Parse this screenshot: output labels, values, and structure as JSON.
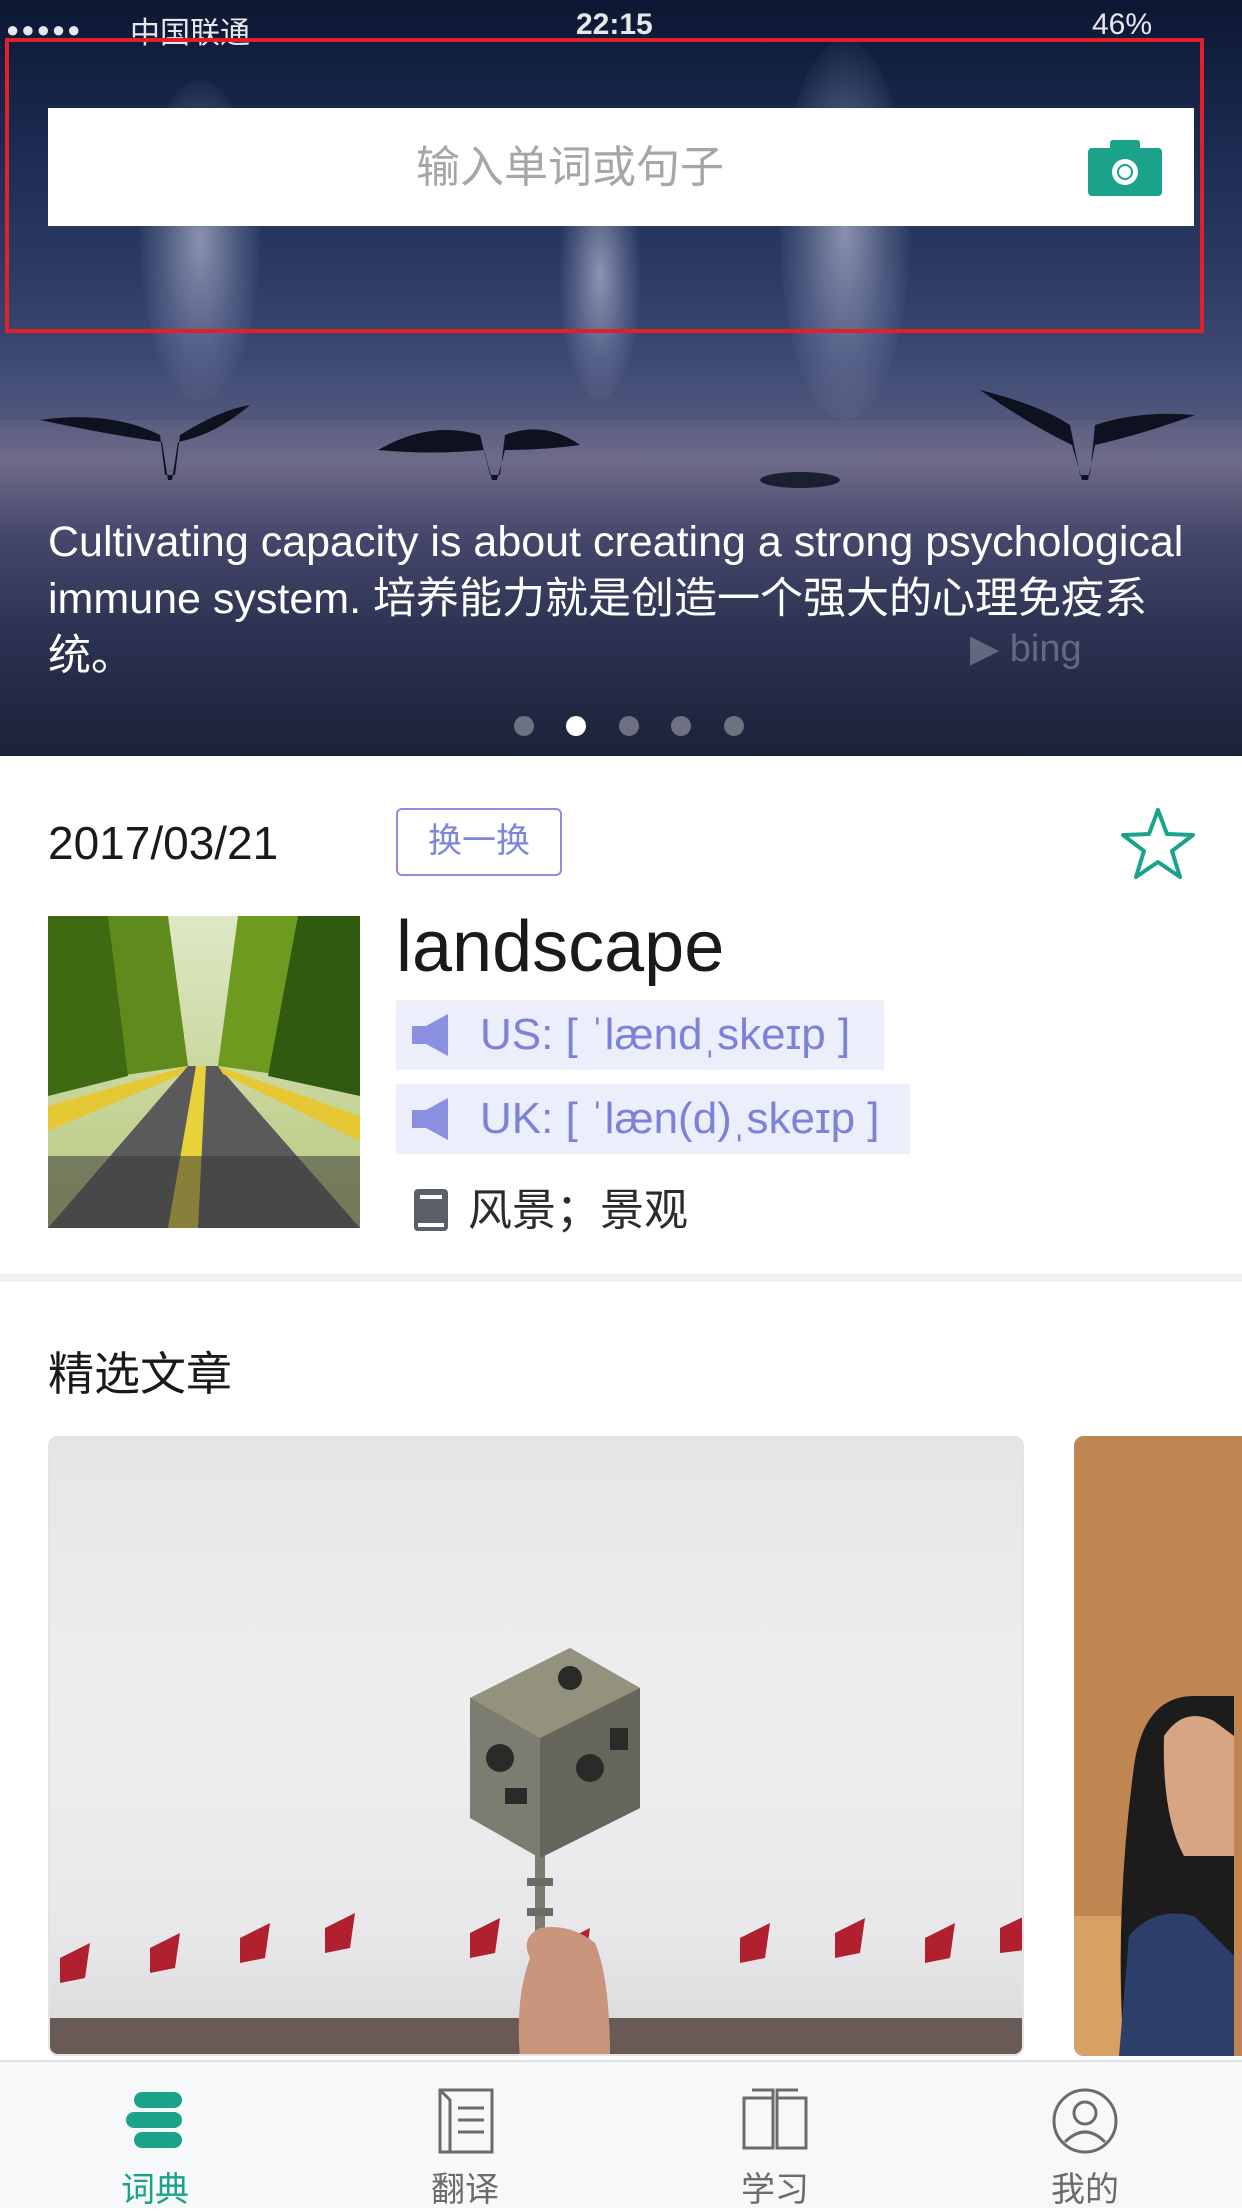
{
  "status_bar": {
    "signal": "●●●●●",
    "carrier": "中国联通",
    "time": "22:15",
    "battery": "46%"
  },
  "search": {
    "placeholder": "输入单词或句子",
    "camera_icon": "camera-icon"
  },
  "hero": {
    "quote": "Cultivating capacity is about creating a strong psychological immune system. 培养能力就是创造一个强大的心理免疫系统。",
    "source_logo": "bing",
    "page_count": 5,
    "active_page": 2
  },
  "word_of_day": {
    "date": "2017/03/21",
    "shuffle_label": "换一换",
    "word": "landscape",
    "pron_us": "US: [ ˈlændˌskeɪp ]",
    "pron_uk": "UK: [ ˈlæn(d)ˌskeɪp ]",
    "definition": "风景；景观"
  },
  "articles": {
    "title": "精选文章"
  },
  "tabbar": {
    "tabs": [
      {
        "label": "词典",
        "icon": "dictionary-icon",
        "active": true
      },
      {
        "label": "翻译",
        "icon": "translate-icon",
        "active": false
      },
      {
        "label": "学习",
        "icon": "study-book-icon",
        "active": false
      },
      {
        "label": "我的",
        "icon": "profile-icon",
        "active": false
      }
    ]
  },
  "colors": {
    "accent": "#1aa38a",
    "pron_text": "#7c82d8",
    "pron_bg": "#edeefb",
    "highlight": "#e0202a"
  }
}
